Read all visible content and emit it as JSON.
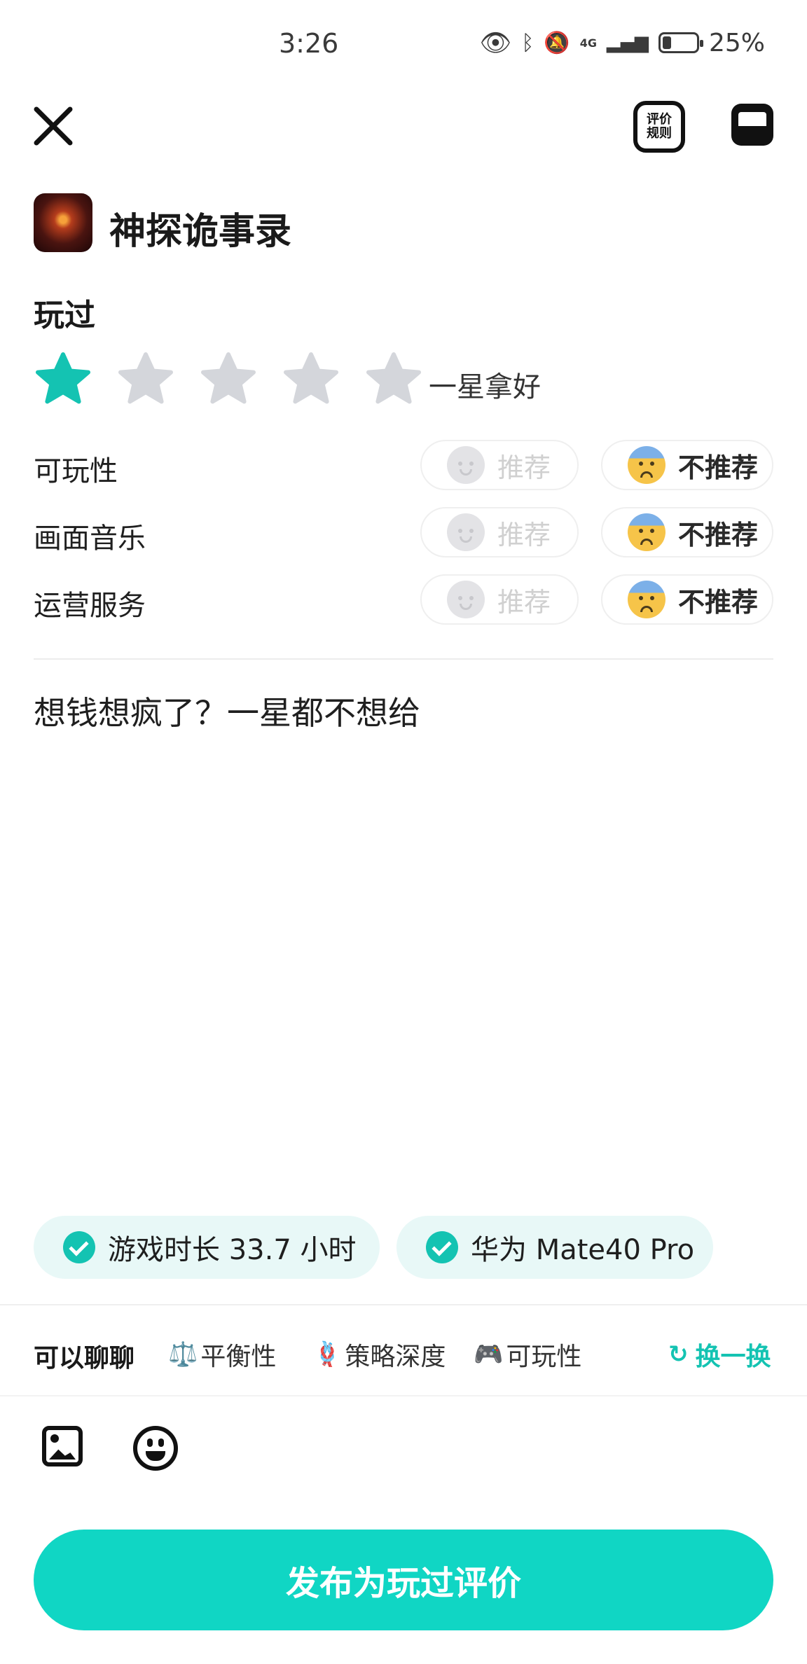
{
  "status_bar": {
    "time": "3:26",
    "network": "4G",
    "battery_percent": "25%",
    "battery_level": 0.25
  },
  "header": {
    "rules_label": "评价规则",
    "close_icon": "close-icon",
    "inbox_icon": "inbox-icon"
  },
  "game": {
    "title": "神探诡事录"
  },
  "review": {
    "status": "玩过",
    "rating": 1,
    "max_rating": 5,
    "rating_text": "一星拿好",
    "text": "想钱想疯了？一星都不想给"
  },
  "aspects": [
    {
      "label": "可玩性",
      "recommend": "推荐",
      "not_recommend": "不推荐",
      "selected": "not_recommend"
    },
    {
      "label": "画面音乐",
      "recommend": "推荐",
      "not_recommend": "不推荐",
      "selected": "not_recommend"
    },
    {
      "label": "运营服务",
      "recommend": "推荐",
      "not_recommend": "不推荐",
      "selected": "not_recommend"
    }
  ],
  "chips": [
    {
      "text": "游戏时长 33.7 小时"
    },
    {
      "text": "华为 Mate40 Pro"
    }
  ],
  "topics": {
    "label": "可以聊聊",
    "items": [
      {
        "emoji": "⚖️",
        "text": "平衡性"
      },
      {
        "emoji": "🪢",
        "text": "策略深度"
      },
      {
        "emoji": "🎮",
        "text": "可玩性"
      }
    ],
    "swap_label": "换一换"
  },
  "publish_button": "发布为玩过评价",
  "colors": {
    "accent": "#10d6c4",
    "star_active": "#14c3b2",
    "star_inactive": "#d4d6db"
  }
}
